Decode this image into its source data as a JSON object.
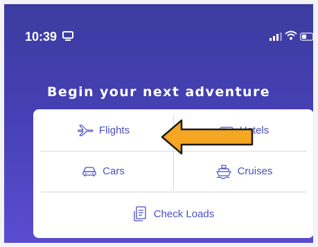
{
  "status_bar": {
    "time": "10:39"
  },
  "heading": "Begin your next adventure",
  "options": {
    "flights": "Flights",
    "hotels": "Hotels",
    "cars": "Cars",
    "cruises": "Cruises",
    "check_loads": "Check Loads"
  },
  "icons": {
    "flights": "airplane-icon",
    "hotels": "hotel-icon",
    "cars": "car-icon",
    "cruises": "ship-icon",
    "check_loads": "document-icon"
  },
  "colors": {
    "background_top": "#3b3ca0",
    "background_bottom": "#5b4cd0",
    "option_text": "#4a4fc0",
    "arrow_fill": "#f5a623",
    "arrow_stroke": "#1b1b1b"
  }
}
